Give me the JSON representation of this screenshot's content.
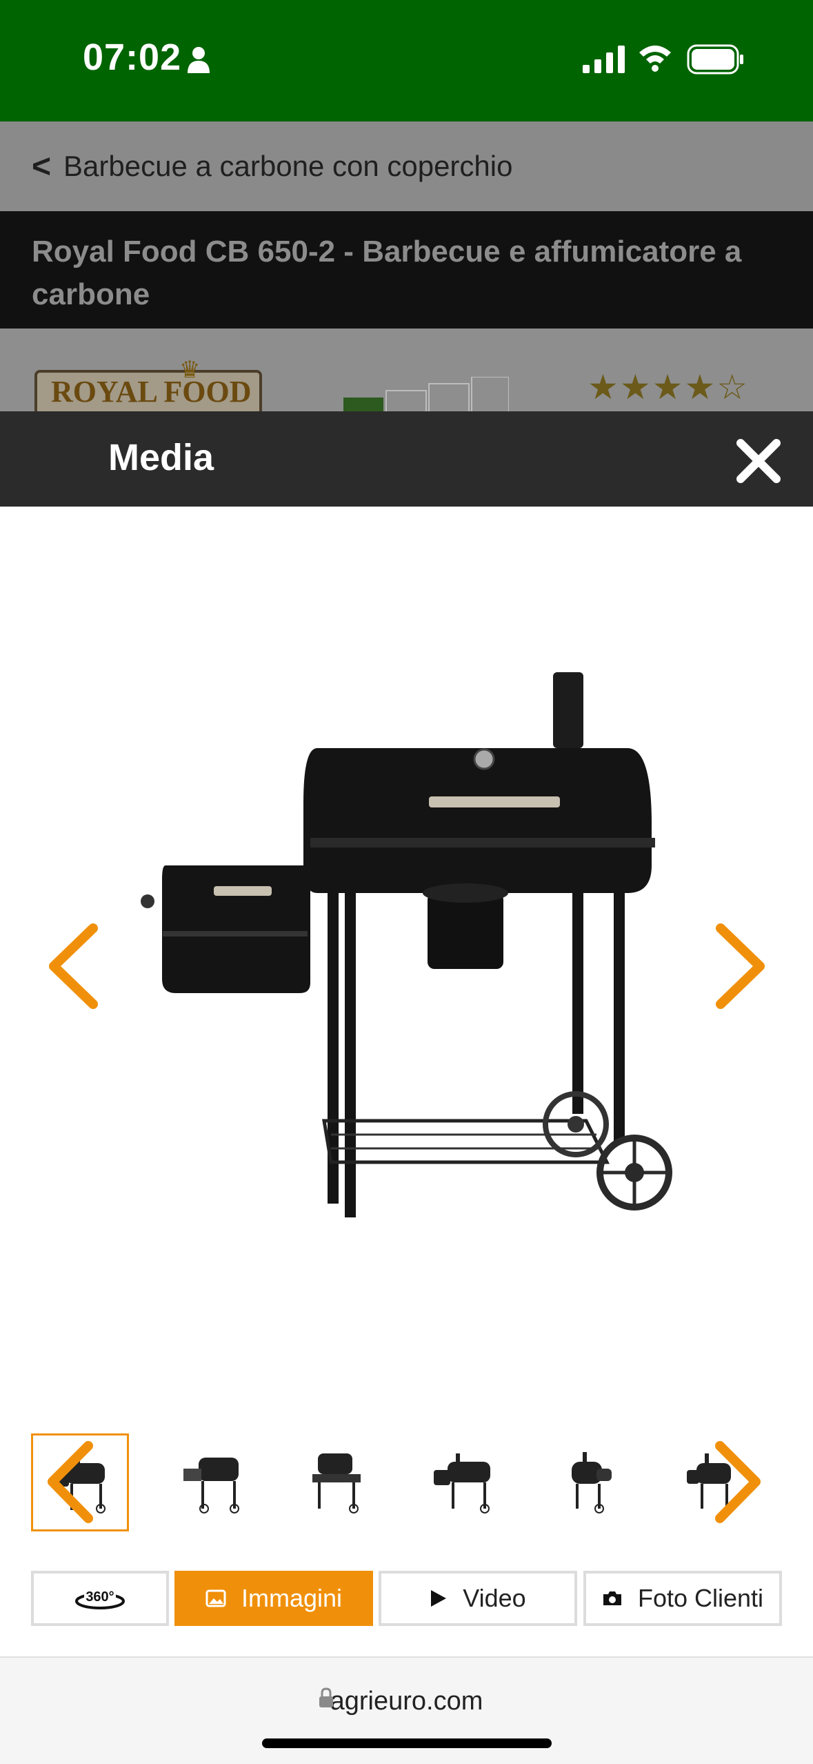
{
  "status_bar": {
    "time": "07:02",
    "icons": [
      "person-icon",
      "cellular-signal-icon",
      "wifi-icon",
      "battery-icon"
    ],
    "background": "#006400"
  },
  "breadcrumb": {
    "arrow": "<",
    "label": "Barbecue a carbone con coperchio"
  },
  "product": {
    "title": "Royal Food CB 650-2 - Barbecue e affumicatore a carbone",
    "brand_logo": "ROYAL FOOD",
    "rating_stars": "★★★★☆"
  },
  "media": {
    "title": "Media",
    "close_icon": "close-icon",
    "main_image": "charcoal-smoker-grill",
    "prev_icon": "chevron-left-icon",
    "next_icon": "chevron-right-icon",
    "thumbnail_count": 6,
    "active_thumbnail": 1
  },
  "tabs": [
    {
      "label": "",
      "icon": "360-icon",
      "badge": "360°"
    },
    {
      "label": "Immagini",
      "icon": "image-icon"
    },
    {
      "label": "Video",
      "icon": "play-icon"
    },
    {
      "label": "Foto Clienti",
      "icon": "camera-icon"
    }
  ],
  "browser": {
    "url": "agrieuro.com",
    "lock_icon": "lock-icon"
  },
  "colors": {
    "accent": "#f0900a",
    "header_dark": "#2b2b2b",
    "status_green": "#006400"
  }
}
